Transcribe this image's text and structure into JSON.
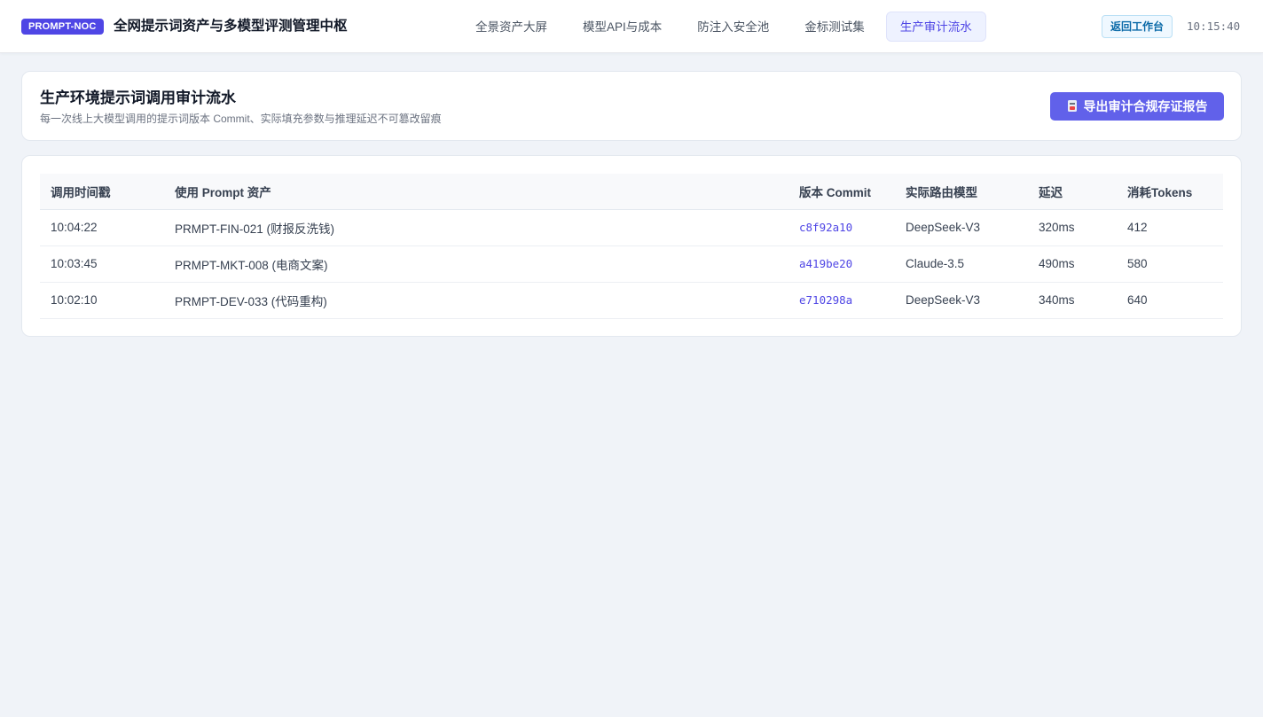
{
  "header": {
    "brand": "PROMPT-NOC",
    "title": "全网提示词资产与多模型评测管理中枢",
    "nav": [
      {
        "label": "全景资产大屏",
        "active": false
      },
      {
        "label": "模型API与成本",
        "active": false
      },
      {
        "label": "防注入安全池",
        "active": false
      },
      {
        "label": "金标测试集",
        "active": false
      },
      {
        "label": "生产审计流水",
        "active": true
      }
    ],
    "back_label": "返回工作台",
    "clock": "10:15:40"
  },
  "page": {
    "title": "生产环境提示词调用审计流水",
    "subtitle": "每一次线上大模型调用的提示词版本 Commit、实际填充参数与推理延迟不可篡改留痕",
    "export_label": "导出审计合规存证报告",
    "export_icon": "report-icon"
  },
  "table": {
    "columns": [
      "调用时间戳",
      "使用 Prompt 资产",
      "版本 Commit",
      "实际路由模型",
      "延迟",
      "消耗Tokens"
    ],
    "rows": [
      {
        "time": "10:04:22",
        "prompt": "PRMPT-FIN-021 (财报反洗钱)",
        "commit": "c8f92a10",
        "model": "DeepSeek-V3",
        "latency": "320ms",
        "tokens": "412"
      },
      {
        "time": "10:03:45",
        "prompt": "PRMPT-MKT-008 (电商文案)",
        "commit": "a419be20",
        "model": "Claude-3.5",
        "latency": "490ms",
        "tokens": "580"
      },
      {
        "time": "10:02:10",
        "prompt": "PRMPT-DEV-033 (代码重构)",
        "commit": "e710298a",
        "model": "DeepSeek-V3",
        "latency": "340ms",
        "tokens": "640"
      }
    ]
  },
  "colors": {
    "brand": "#4f46e5",
    "accent": "#6161ea",
    "commit_text": "#4f46e5",
    "background": "#f0f3f8"
  }
}
